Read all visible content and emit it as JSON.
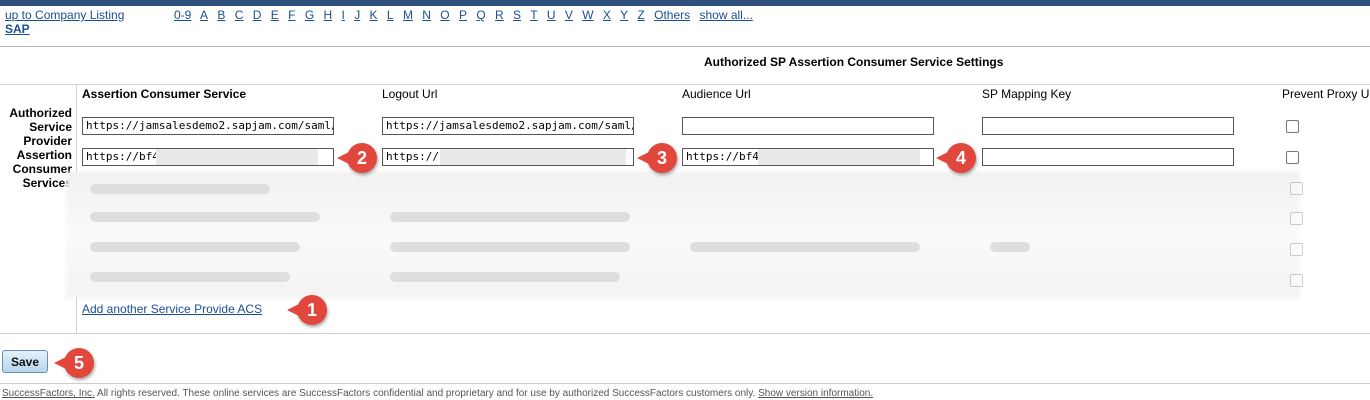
{
  "nav": {
    "up_link": "up to Company Listing",
    "company_link": "SAP",
    "alphabet": [
      "0-9",
      "A",
      "B",
      "C",
      "D",
      "E",
      "F",
      "G",
      "H",
      "I",
      "J",
      "K",
      "L",
      "M",
      "N",
      "O",
      "P",
      "Q",
      "R",
      "S",
      "T",
      "U",
      "V",
      "W",
      "X",
      "Y",
      "Z",
      "Others",
      "show all..."
    ]
  },
  "section_title": "Authorized SP Assertion Consumer Service Settings",
  "row_label": "Authorized Service Provider Assertion Consumer Services",
  "columns": {
    "acs": "Assertion Consumer Service",
    "logout": "Logout Url",
    "audience": "Audience Url",
    "mapping": "SP Mapping Key",
    "proxy": "Prevent Proxy U"
  },
  "rows": [
    {
      "acs": "https://jamsalesdemo2.sapjam.com/saml/saml2/",
      "logout": "https://jamsalesdemo2.sapjam.com/saml/saml2/",
      "audience": "",
      "mapping": ""
    },
    {
      "acs": "https://bf4c5",
      "logout": "https://bf",
      "audience": "https://bf4c5",
      "mapping": ""
    }
  ],
  "add_link": "Add another Service Provide ACS",
  "save_label": "Save",
  "callouts": [
    "1",
    "2",
    "3",
    "4",
    "5"
  ],
  "footer": {
    "company": "SuccessFactors, Inc.",
    "text": " All rights reserved. These online services are SuccessFactors confidential and proprietary and for use by authorized SuccessFactors customers only. ",
    "version_link": "Show version information."
  },
  "colors": {
    "accent_link": "#1a4f91",
    "callout": "#e2473e",
    "top_bar": "#2f4f7c"
  }
}
